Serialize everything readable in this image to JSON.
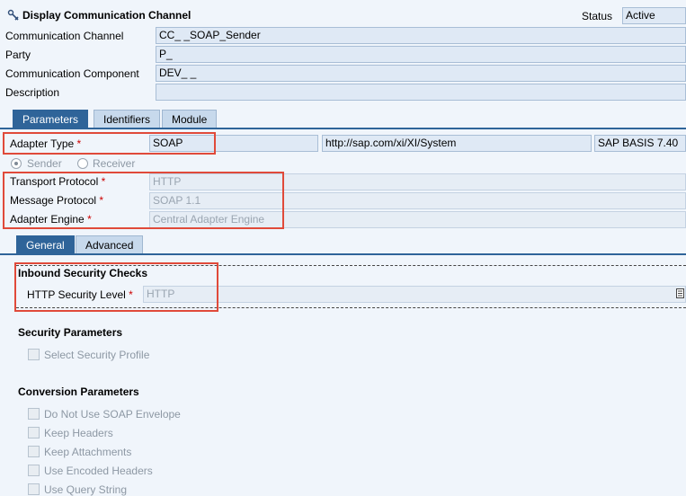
{
  "header": {
    "title": "Display Communication Channel",
    "status_label": "Status",
    "status_value": "Active"
  },
  "general": {
    "channel_label": "Communication Channel",
    "channel_value": "CC_                    _SOAP_Sender",
    "party_label": "Party",
    "party_value": "P_",
    "component_label": "Communication Component",
    "component_value": "DEV_    _",
    "description_label": "Description",
    "description_value": ""
  },
  "tabs_main": [
    {
      "label": "Parameters"
    },
    {
      "label": "Identifiers"
    },
    {
      "label": "Module"
    }
  ],
  "adapter": {
    "type_label": "Adapter Type",
    "type_value": "SOAP",
    "namespace_value": "http://sap.com/xi/XI/System",
    "release_value": "SAP BASIS 7.40",
    "sender_label": "Sender",
    "receiver_label": "Receiver",
    "transport_label": "Transport Protocol",
    "transport_value": "HTTP",
    "message_label": "Message Protocol",
    "message_value": "SOAP 1.1",
    "engine_label": "Adapter Engine",
    "engine_value": "Central Adapter Engine",
    "required_mark": "*"
  },
  "tabs_sub": [
    {
      "label": "General"
    },
    {
      "label": "Advanced"
    }
  ],
  "inbound": {
    "title": "Inbound Security Checks",
    "level_label": "HTTP Security Level",
    "level_value": "HTTP"
  },
  "security": {
    "title": "Security Parameters",
    "profile_label": "Select Security Profile"
  },
  "conversion": {
    "title": "Conversion Parameters",
    "options": [
      {
        "label": "Do Not Use SOAP Envelope"
      },
      {
        "label": "Keep Headers"
      },
      {
        "label": "Keep Attachments"
      },
      {
        "label": "Use Encoded Headers"
      },
      {
        "label": "Use Query String"
      }
    ]
  }
}
